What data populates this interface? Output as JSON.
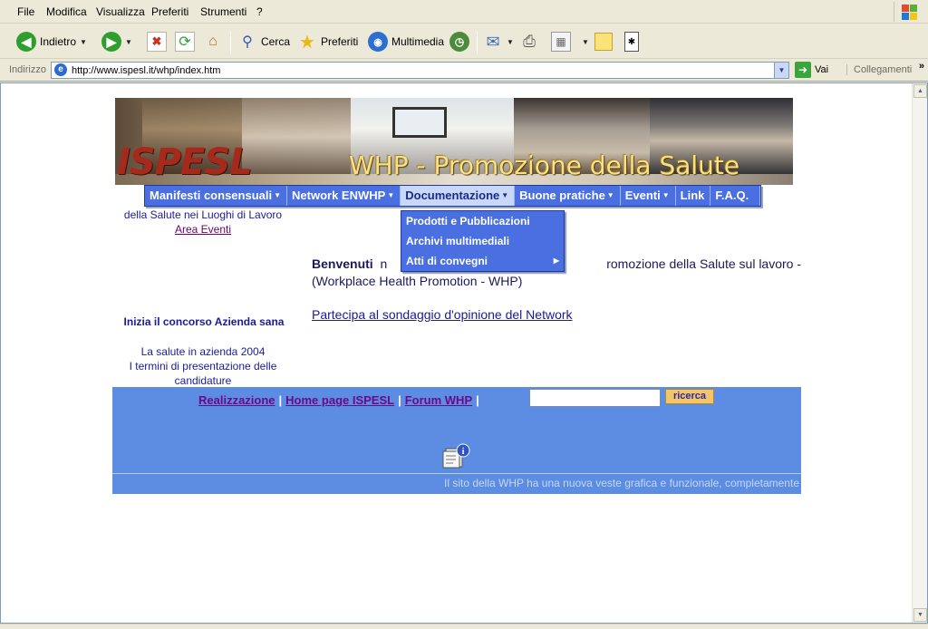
{
  "menu": [
    "File",
    "Modifica",
    "Visualizza",
    "Preferiti",
    "Strumenti",
    "?"
  ],
  "toolbar": {
    "back": "Indietro",
    "search": "Cerca",
    "favorites": "Preferiti",
    "media": "Multimedia"
  },
  "address": {
    "label": "Indirizzo",
    "url": "http://www.ispesl.it/whp/index.htm",
    "go": "Vai",
    "links": "Collegamenti",
    "more": "»"
  },
  "page": {
    "logo": "ISPESL",
    "banner_title": "WHP - Promozione della Salute",
    "nav": [
      {
        "label": "Manifesti consensuali",
        "has_sub": true
      },
      {
        "label": "Network ENWHP",
        "has_sub": true
      },
      {
        "label": "Documentazione",
        "has_sub": true,
        "active": true
      },
      {
        "label": "Buone pratiche",
        "has_sub": true
      },
      {
        "label": "Eventi",
        "has_sub": true
      },
      {
        "label": "Link",
        "has_sub": false
      },
      {
        "label": "F.A.Q.",
        "has_sub": false
      }
    ],
    "dropdown": [
      {
        "label": "Prodotti e Pubblicazioni",
        "has_sub": false
      },
      {
        "label": "Archivi multimediali",
        "has_sub": false
      },
      {
        "label": "Atti di convegni",
        "has_sub": true
      }
    ],
    "left": {
      "line1": "della Salute nei Luoghi di Lavoro",
      "area_link": "Area Eventi",
      "concorso": "Inizia il concorso Azienda sana",
      "salute1": "La salute in azienda 2004",
      "salute2": "I termini di presentazione delle",
      "salute3": "candidature"
    },
    "welcome_bold": "Benvenuti",
    "welcome_visible_head": "n",
    "welcome_rest": "romozione della Salute sul lavoro -",
    "welcome_line2": "(Workplace Health Promotion - WHP)",
    "poll": "Partecipa al sondaggio d'opinione del Network",
    "footer": {
      "link1": "Realizzazione",
      "link2": "Home page ISPESL",
      "link3": "Forum WHP",
      "sep": "|",
      "search_value": "",
      "search_button": "ricerca",
      "ticker": "Il sito della WHP ha una nuova veste grafica e funzionale, completamente"
    }
  },
  "colors": {
    "nav_bg": "#4a6fe0",
    "footer_bg": "#5c8de2",
    "text_blue": "#1a1a9a"
  }
}
